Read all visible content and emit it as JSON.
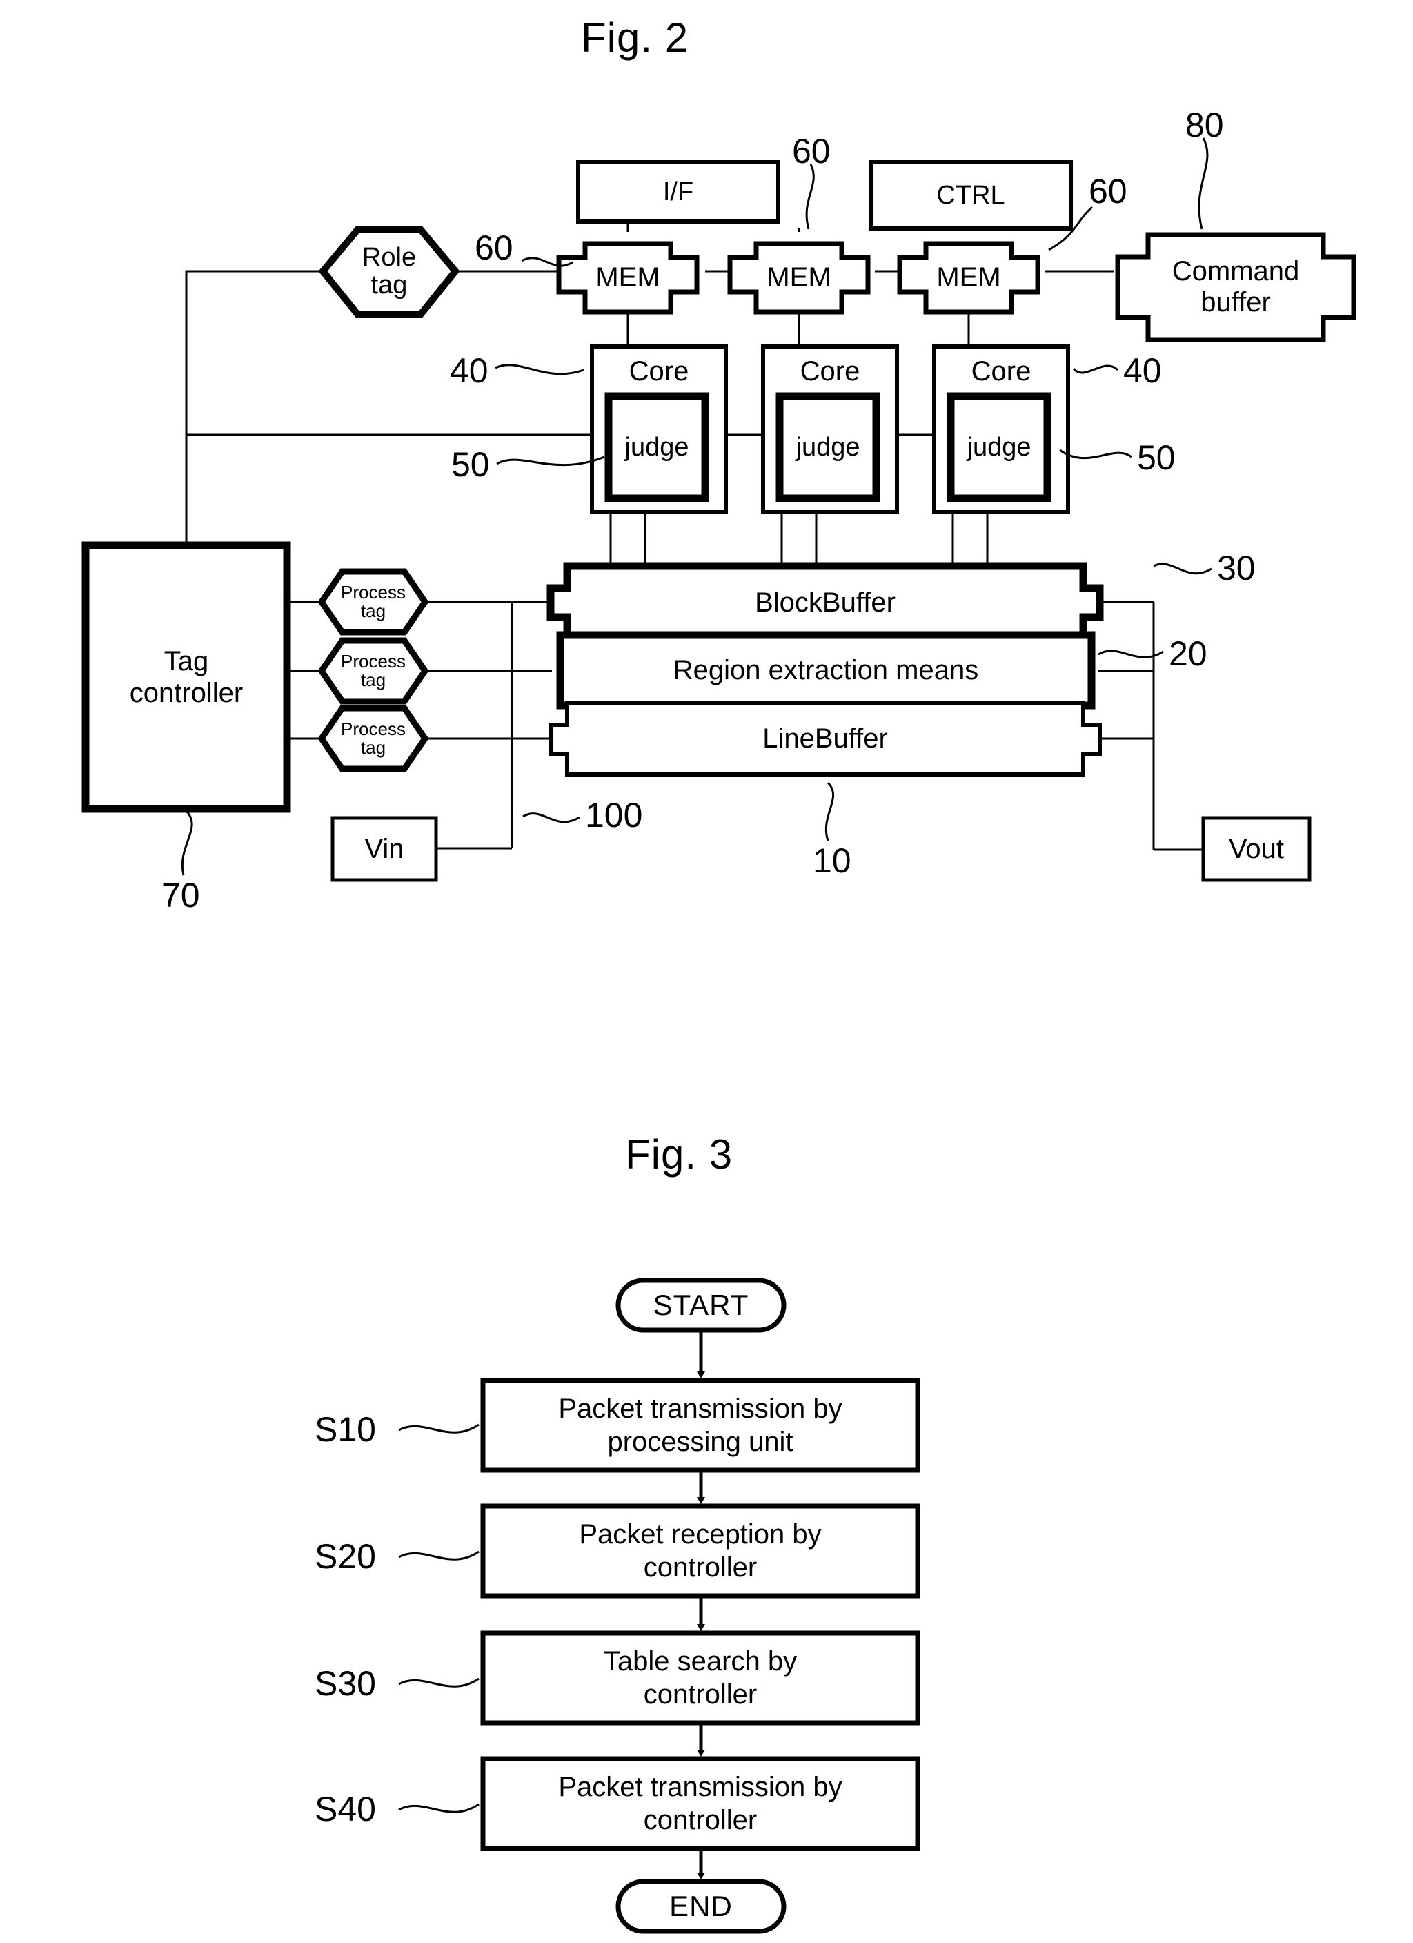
{
  "figures": [
    {
      "id": "fig2",
      "title": "Fig. 2",
      "blocks": {
        "iface": "I/F",
        "ctrl": "CTRL",
        "mem1": "MEM",
        "mem2": "MEM",
        "mem3": "MEM",
        "core1": "Core",
        "core2": "Core",
        "core3": "Core",
        "judge1": "judge",
        "judge2": "judge",
        "judge3": "judge",
        "command_buffer": "Command buffer",
        "command_buffer_line1": "Command",
        "command_buffer_line2": "buffer",
        "role_tag_line1": "Role",
        "role_tag_line2": "tag",
        "process_tag_line1": "Process",
        "process_tag_line2": "tag",
        "tag_controller_line1": "Tag",
        "tag_controller_line2": "controller",
        "block_buffer": "BlockBuffer",
        "region_extraction": "Region extraction means",
        "line_buffer": "LineBuffer",
        "vin": "Vin",
        "vout": "Vout"
      },
      "reference_numerals": {
        "n60_a": "60",
        "n60_b": "60",
        "n60_c": "60",
        "n80": "80",
        "n40_left": "40",
        "n40_right": "40",
        "n50_left": "50",
        "n50_right": "50",
        "n30": "30",
        "n20": "20",
        "n70": "70",
        "n100": "100",
        "n10": "10"
      }
    },
    {
      "id": "fig3",
      "title": "Fig. 3",
      "terminals": {
        "start": "START",
        "end": "END"
      },
      "steps": [
        {
          "ref": "S10",
          "line1": "Packet transmission by",
          "line2": "processing unit"
        },
        {
          "ref": "S20",
          "line1": "Packet reception by",
          "line2": "controller"
        },
        {
          "ref": "S30",
          "line1": "Table search by",
          "line2": "controller"
        },
        {
          "ref": "S40",
          "line1": "Packet transmission by",
          "line2": "controller"
        }
      ]
    }
  ],
  "colors": {
    "ink": "#000000",
    "paper": "#ffffff"
  }
}
